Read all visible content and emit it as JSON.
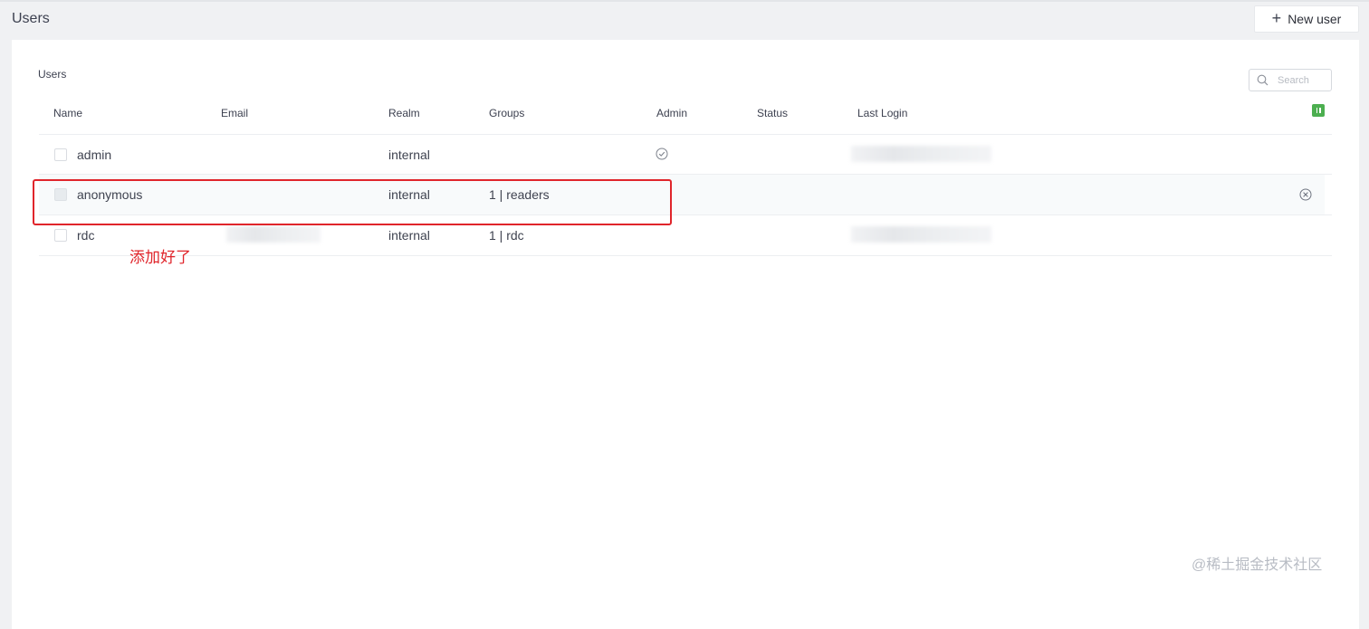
{
  "header": {
    "title": "Users",
    "new_user_label": "New user"
  },
  "panel": {
    "title": "Users",
    "search_placeholder": "Search",
    "columns": [
      "Name",
      "Email",
      "Realm",
      "Groups",
      "Admin",
      "Status",
      "Last Login"
    ],
    "rows": [
      {
        "name": "admin",
        "email": "",
        "realm": "internal",
        "groups": "",
        "admin": true,
        "status": "",
        "last_login": ""
      },
      {
        "name": "anonymous",
        "email": "",
        "realm": "internal",
        "groups": "1 | readers",
        "admin": false,
        "status": "",
        "last_login": ""
      },
      {
        "name": "rdc",
        "email": "",
        "realm": "internal",
        "groups": "1 | rdc",
        "admin": false,
        "status": "",
        "last_login": ""
      }
    ]
  },
  "annotation": {
    "text": "添加好了"
  },
  "watermark": "@稀土掘金技术社区",
  "colors": {
    "accent": "#4caf50",
    "highlight": "#e0252b"
  }
}
